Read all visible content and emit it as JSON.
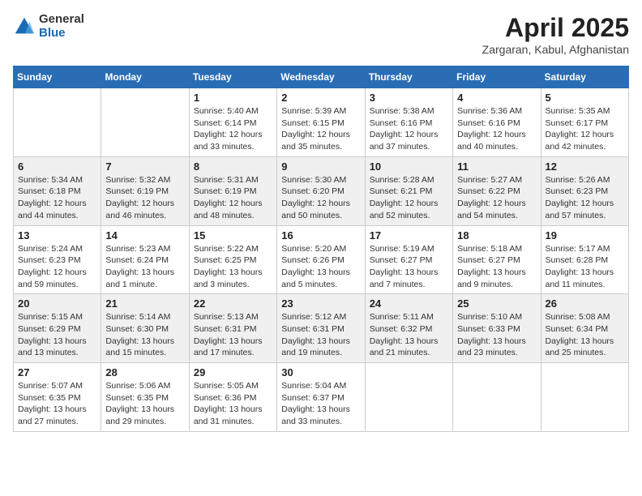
{
  "logo": {
    "general": "General",
    "blue": "Blue"
  },
  "title": "April 2025",
  "location": "Zargaran, Kabul, Afghanistan",
  "weekdays": [
    "Sunday",
    "Monday",
    "Tuesday",
    "Wednesday",
    "Thursday",
    "Friday",
    "Saturday"
  ],
  "weeks": [
    [
      {
        "day": "",
        "sunrise": "",
        "sunset": "",
        "daylight": ""
      },
      {
        "day": "",
        "sunrise": "",
        "sunset": "",
        "daylight": ""
      },
      {
        "day": "1",
        "sunrise": "Sunrise: 5:40 AM",
        "sunset": "Sunset: 6:14 PM",
        "daylight": "Daylight: 12 hours and 33 minutes."
      },
      {
        "day": "2",
        "sunrise": "Sunrise: 5:39 AM",
        "sunset": "Sunset: 6:15 PM",
        "daylight": "Daylight: 12 hours and 35 minutes."
      },
      {
        "day": "3",
        "sunrise": "Sunrise: 5:38 AM",
        "sunset": "Sunset: 6:16 PM",
        "daylight": "Daylight: 12 hours and 37 minutes."
      },
      {
        "day": "4",
        "sunrise": "Sunrise: 5:36 AM",
        "sunset": "Sunset: 6:16 PM",
        "daylight": "Daylight: 12 hours and 40 minutes."
      },
      {
        "day": "5",
        "sunrise": "Sunrise: 5:35 AM",
        "sunset": "Sunset: 6:17 PM",
        "daylight": "Daylight: 12 hours and 42 minutes."
      }
    ],
    [
      {
        "day": "6",
        "sunrise": "Sunrise: 5:34 AM",
        "sunset": "Sunset: 6:18 PM",
        "daylight": "Daylight: 12 hours and 44 minutes."
      },
      {
        "day": "7",
        "sunrise": "Sunrise: 5:32 AM",
        "sunset": "Sunset: 6:19 PM",
        "daylight": "Daylight: 12 hours and 46 minutes."
      },
      {
        "day": "8",
        "sunrise": "Sunrise: 5:31 AM",
        "sunset": "Sunset: 6:19 PM",
        "daylight": "Daylight: 12 hours and 48 minutes."
      },
      {
        "day": "9",
        "sunrise": "Sunrise: 5:30 AM",
        "sunset": "Sunset: 6:20 PM",
        "daylight": "Daylight: 12 hours and 50 minutes."
      },
      {
        "day": "10",
        "sunrise": "Sunrise: 5:28 AM",
        "sunset": "Sunset: 6:21 PM",
        "daylight": "Daylight: 12 hours and 52 minutes."
      },
      {
        "day": "11",
        "sunrise": "Sunrise: 5:27 AM",
        "sunset": "Sunset: 6:22 PM",
        "daylight": "Daylight: 12 hours and 54 minutes."
      },
      {
        "day": "12",
        "sunrise": "Sunrise: 5:26 AM",
        "sunset": "Sunset: 6:23 PM",
        "daylight": "Daylight: 12 hours and 57 minutes."
      }
    ],
    [
      {
        "day": "13",
        "sunrise": "Sunrise: 5:24 AM",
        "sunset": "Sunset: 6:23 PM",
        "daylight": "Daylight: 12 hours and 59 minutes."
      },
      {
        "day": "14",
        "sunrise": "Sunrise: 5:23 AM",
        "sunset": "Sunset: 6:24 PM",
        "daylight": "Daylight: 13 hours and 1 minute."
      },
      {
        "day": "15",
        "sunrise": "Sunrise: 5:22 AM",
        "sunset": "Sunset: 6:25 PM",
        "daylight": "Daylight: 13 hours and 3 minutes."
      },
      {
        "day": "16",
        "sunrise": "Sunrise: 5:20 AM",
        "sunset": "Sunset: 6:26 PM",
        "daylight": "Daylight: 13 hours and 5 minutes."
      },
      {
        "day": "17",
        "sunrise": "Sunrise: 5:19 AM",
        "sunset": "Sunset: 6:27 PM",
        "daylight": "Daylight: 13 hours and 7 minutes."
      },
      {
        "day": "18",
        "sunrise": "Sunrise: 5:18 AM",
        "sunset": "Sunset: 6:27 PM",
        "daylight": "Daylight: 13 hours and 9 minutes."
      },
      {
        "day": "19",
        "sunrise": "Sunrise: 5:17 AM",
        "sunset": "Sunset: 6:28 PM",
        "daylight": "Daylight: 13 hours and 11 minutes."
      }
    ],
    [
      {
        "day": "20",
        "sunrise": "Sunrise: 5:15 AM",
        "sunset": "Sunset: 6:29 PM",
        "daylight": "Daylight: 13 hours and 13 minutes."
      },
      {
        "day": "21",
        "sunrise": "Sunrise: 5:14 AM",
        "sunset": "Sunset: 6:30 PM",
        "daylight": "Daylight: 13 hours and 15 minutes."
      },
      {
        "day": "22",
        "sunrise": "Sunrise: 5:13 AM",
        "sunset": "Sunset: 6:31 PM",
        "daylight": "Daylight: 13 hours and 17 minutes."
      },
      {
        "day": "23",
        "sunrise": "Sunrise: 5:12 AM",
        "sunset": "Sunset: 6:31 PM",
        "daylight": "Daylight: 13 hours and 19 minutes."
      },
      {
        "day": "24",
        "sunrise": "Sunrise: 5:11 AM",
        "sunset": "Sunset: 6:32 PM",
        "daylight": "Daylight: 13 hours and 21 minutes."
      },
      {
        "day": "25",
        "sunrise": "Sunrise: 5:10 AM",
        "sunset": "Sunset: 6:33 PM",
        "daylight": "Daylight: 13 hours and 23 minutes."
      },
      {
        "day": "26",
        "sunrise": "Sunrise: 5:08 AM",
        "sunset": "Sunset: 6:34 PM",
        "daylight": "Daylight: 13 hours and 25 minutes."
      }
    ],
    [
      {
        "day": "27",
        "sunrise": "Sunrise: 5:07 AM",
        "sunset": "Sunset: 6:35 PM",
        "daylight": "Daylight: 13 hours and 27 minutes."
      },
      {
        "day": "28",
        "sunrise": "Sunrise: 5:06 AM",
        "sunset": "Sunset: 6:35 PM",
        "daylight": "Daylight: 13 hours and 29 minutes."
      },
      {
        "day": "29",
        "sunrise": "Sunrise: 5:05 AM",
        "sunset": "Sunset: 6:36 PM",
        "daylight": "Daylight: 13 hours and 31 minutes."
      },
      {
        "day": "30",
        "sunrise": "Sunrise: 5:04 AM",
        "sunset": "Sunset: 6:37 PM",
        "daylight": "Daylight: 13 hours and 33 minutes."
      },
      {
        "day": "",
        "sunrise": "",
        "sunset": "",
        "daylight": ""
      },
      {
        "day": "",
        "sunrise": "",
        "sunset": "",
        "daylight": ""
      },
      {
        "day": "",
        "sunrise": "",
        "sunset": "",
        "daylight": ""
      }
    ]
  ]
}
